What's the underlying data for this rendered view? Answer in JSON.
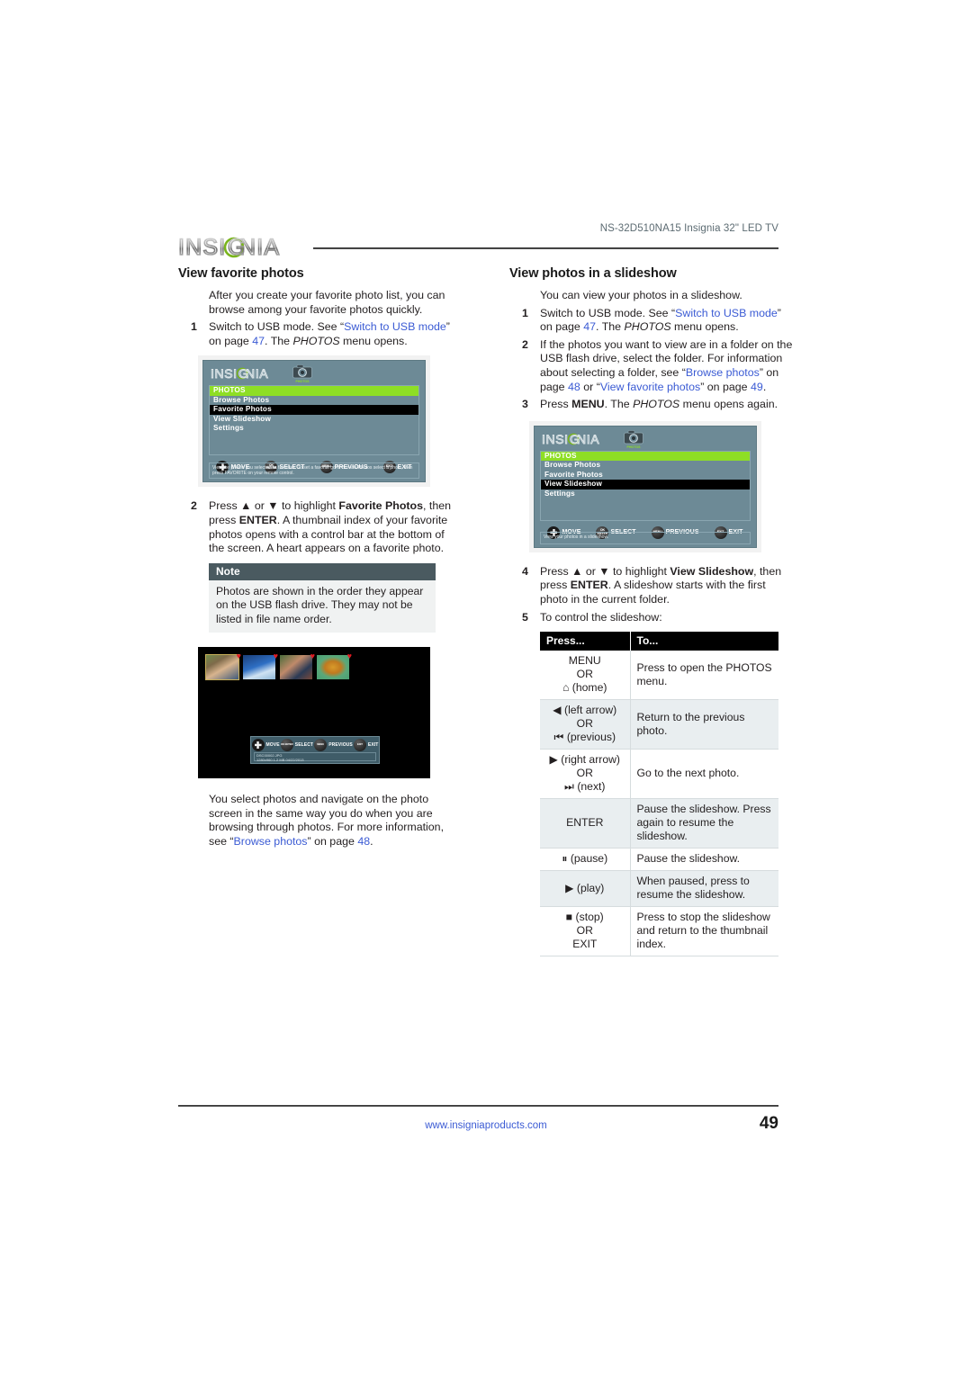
{
  "header": {
    "model_line": "NS-32D510NA15 Insignia 32\" LED TV",
    "logo_text": "INSIGNIA"
  },
  "left_column": {
    "title": "View favorite photos",
    "intro": "After you create your favorite photo list, you can browse among your favorite photos quickly.",
    "step1": {
      "num": "1",
      "t1": "Switch to USB mode. See “",
      "link": "Switch to USB mode",
      "t2": "” on page ",
      "page": "47",
      "t3": ". The ",
      "ital": "PHOTOS",
      "t4": " menu opens."
    },
    "step2": {
      "num": "2",
      "t1": "Press ▲ or ▼ to highlight ",
      "b1": "Favorite Photos",
      "t2": ", then press ",
      "b2": "ENTER",
      "t3": ". A thumbnail index of your favorite photos opens with a control bar at the bottom of the screen. A heart appears on a favorite photo."
    },
    "note": {
      "heading": "Note",
      "body": "Photos are shown in the order they appear on the USB flash drive. They may not be listed in file name order."
    },
    "closing": {
      "t1": "You select photos and navigate on the photo screen in the same way you do when you are browsing through photos. For more information, see “",
      "link": "Browse photos",
      "t2": "” on page ",
      "page": "48",
      "t3": "."
    }
  },
  "right_column": {
    "title": "View photos in a slideshow",
    "intro": "You can view your photos in a slideshow.",
    "step1": {
      "num": "1",
      "t1": "Switch to USB mode. See “",
      "link": "Switch to USB mode",
      "t2": "” on page ",
      "page": "47",
      "t3": ". The ",
      "ital": "PHOTOS",
      "t4": " menu opens."
    },
    "step2": {
      "num": "2",
      "t1": "If the photos you want to view are in a folder on the USB flash drive, select the folder. For information about selecting a folder, see “",
      "link1": "Browse photos",
      "t2": "” on page ",
      "page1": "48",
      "t3": " or “",
      "link2": "View favorite photos",
      "t4": "” on page ",
      "page2": "49",
      "t5": "."
    },
    "step3": {
      "num": "3",
      "t1": "Press ",
      "b1": "MENU",
      "t2": ". The ",
      "ital": "PHOTOS",
      "t3": " menu opens again."
    },
    "step4": {
      "num": "4",
      "t1": "Press ▲ or ▼ to highlight ",
      "b1": "View Slideshow",
      "t2": ", then press ",
      "b2": "ENTER",
      "t3": ". A slideshow starts with the first photo in the current folder."
    },
    "step5": {
      "num": "5",
      "t1": "To control the slideshow:"
    }
  },
  "tv_osd_1": {
    "logo_text": "INSIGNIA",
    "camera_label": "PHOTOS",
    "rows": [
      {
        "label": "PHOTOS",
        "state": "title"
      },
      {
        "label": "Browse Photos",
        "state": "normal"
      },
      {
        "label": "Favorite Photos",
        "state": "selected"
      },
      {
        "label": "View Slideshow",
        "state": "normal"
      },
      {
        "label": "Settings",
        "state": "normal"
      }
    ],
    "buttons": [
      {
        "glyph": "dpad",
        "label": "MOVE"
      },
      {
        "glyph": "OK ENTER",
        "label": "SELECT"
      },
      {
        "glyph": "MENU",
        "label": "PREVIOUS"
      },
      {
        "glyph": "EXIT",
        "label": "EXIT"
      }
    ],
    "caption": "View the photos you selected as favorites. To set a favorite go to Browse Photos select a photo, then press FAVORITE on your remote control."
  },
  "tv_osd_2": {
    "logo_text": "INSIGNIA",
    "camera_label": "PHOTOS",
    "rows": [
      {
        "label": "PHOTOS",
        "state": "title"
      },
      {
        "label": "Browse Photos",
        "state": "normal"
      },
      {
        "label": "Favorite Photos",
        "state": "normal"
      },
      {
        "label": "View Slideshow",
        "state": "selected"
      },
      {
        "label": "Settings",
        "state": "normal"
      }
    ],
    "buttons": [
      {
        "glyph": "dpad",
        "label": "MOVE"
      },
      {
        "glyph": "OK ENTER",
        "label": "SELECT"
      },
      {
        "glyph": "MENU",
        "label": "PREVIOUS"
      },
      {
        "glyph": "EXIT",
        "label": "EXIT"
      }
    ],
    "caption": "View your photos in a slideshow."
  },
  "thumb_index": {
    "thumbnails": [
      {
        "name": "photo-portrait-man",
        "heart": "♥",
        "selected": true
      },
      {
        "name": "photo-blue-boat",
        "heart": "♥",
        "selected": false
      },
      {
        "name": "photo-woman-outdoors",
        "heart": "♥",
        "selected": false
      },
      {
        "name": "photo-autumn-leaf",
        "heart": "♥",
        "selected": false
      }
    ],
    "buttons": [
      {
        "glyph": "dpad",
        "label": "MOVE"
      },
      {
        "glyph": "OK ENTER",
        "label": "SELECT"
      },
      {
        "glyph": "MENU",
        "label": "PREVIOUS"
      },
      {
        "glyph": "EXIT",
        "label": "EXIT"
      }
    ],
    "info_line1": "DSC00002.JPG",
    "info_line2": "1280x960   1.2 MB   04/22/2013"
  },
  "key_table": {
    "columns": [
      "Press...",
      "To..."
    ],
    "rows": [
      {
        "press_lines": [
          "MENU",
          "OR",
          "⌂ (home)"
        ],
        "to": "Press to open the PHOTOS menu.",
        "shade": "plain"
      },
      {
        "press_lines": [
          "◀ (left arrow)",
          "OR",
          "⏮ (previous)"
        ],
        "to": "Return to the previous photo.",
        "shade": "alt"
      },
      {
        "press_lines": [
          "▶ (right arrow)",
          "OR",
          "⏭ (next)"
        ],
        "to": "Go to the next photo.",
        "shade": "plain"
      },
      {
        "press_lines": [
          "ENTER"
        ],
        "to": "Pause the slideshow. Press again to resume the slideshow.",
        "shade": "alt"
      },
      {
        "press_lines": [
          "⏸ (pause)"
        ],
        "to": "Pause the slideshow.",
        "shade": "plain"
      },
      {
        "press_lines": [
          "▶ (play)"
        ],
        "to": "When paused, press to resume the slideshow.",
        "shade": "alt"
      },
      {
        "press_lines": [
          "■ (stop)",
          "OR",
          "EXIT"
        ],
        "to": "Press to stop the slideshow and return to the thumbnail index.",
        "shade": "plain"
      }
    ]
  },
  "footer": {
    "url": "www.insigniaproducts.com",
    "page_number": "49"
  },
  "colors": {
    "link": "#3b5bd4",
    "osd_bg": "#6d8a96",
    "osd_title_green": "#8ede25",
    "note_header": "#4a5a60",
    "table_alt": "#e9eef0",
    "heart_red": "#e01b22"
  }
}
